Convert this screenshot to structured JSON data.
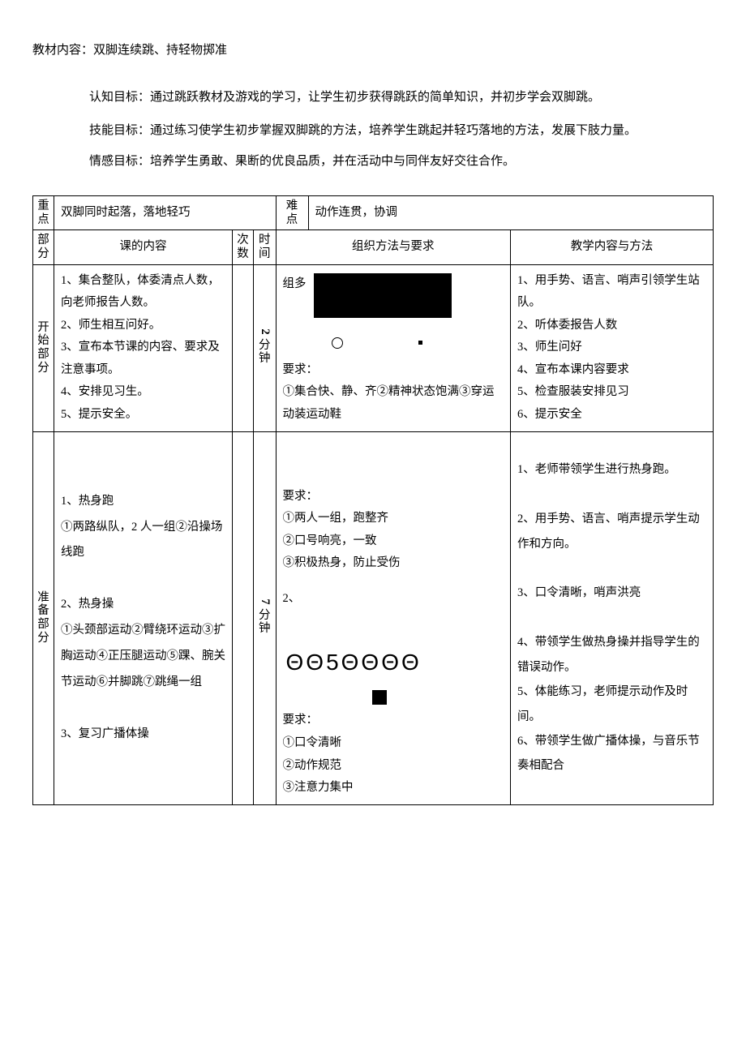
{
  "title": "教材内容：双脚连续跳、持轻物掷准",
  "objectives": {
    "cognitive": "认知目标：通过跳跃教材及游戏的学习，让学生初步获得跳跃的简单知识，并初步学会双脚跳。",
    "skill": "技能目标：通过练习使学生初步掌握双脚跳的方法，培养学生跳起并轻巧落地的方法，发展下肢力量。",
    "emotion": "情感目标：培养学生勇敢、果断的优良品质，并在活动中与同伴友好交往合作。"
  },
  "focus_row": {
    "label": "重点",
    "focus": "双脚同时起落，落地轻巧",
    "difficulty_label": "难点",
    "difficulty": "动作连贯，协调"
  },
  "headers": {
    "part": "部分",
    "content": "课的内容",
    "times": "次数",
    "duration": "时间",
    "organization": "组织方法与要求",
    "methods": "教学内容与方法"
  },
  "sections": [
    {
      "part_label": "开始部分",
      "content": "1、集合整队，体委清点人数，向老师报告人数。\n2、师生相互问好。\n3、宣布本节课的内容、要求及注意事项。\n4、安排见习生。\n5、提示安全。",
      "times": "",
      "duration_num": "2",
      "duration_unit": "分钟",
      "org_prefix": "组多",
      "org_req_label": "要求：",
      "org_req": "①集合快、静、齐②精神状态饱满③穿运动装运动鞋",
      "methods": "1、用手势、语言、哨声引领学生站队。\n2、听体委报告人数\n3、师生问好\n4、宣布本课内容要求\n5、检查服装安排见习\n6、提示安全"
    },
    {
      "part_label": "准备部分",
      "content": "1、热身跑\n①两路纵队，2 人一组②沿操场线跑\n\n2、热身操\n①头颈部运动②臂绕环运动③扩胸运动④正压腿运动⑤踝、腕关节运动⑥并脚跳⑦跳绳一组\n\n3、复习广播体操",
      "times": "",
      "duration_num": "7",
      "duration_unit": "分钟",
      "org_req1_label": "要求：",
      "org_req1": "①两人一组，跑整齐\n②口号响亮，一致\n③积极热身，防止受伤",
      "org_item2": "2、",
      "org_symbols": "ΘΘ5ΘΘΘΘ",
      "org_req2_label": "要求：",
      "org_req2": "①口令清晰\n②动作规范\n③注意力集中",
      "methods": "1、老师带领学生进行热身跑。\n\n2、用手势、语言、哨声提示学生动作和方向。\n\n3、口令清晰，哨声洪亮\n\n4、带领学生做热身操并指导学生的错误动作。\n5、体能练习，老师提示动作及时间。\n6、带领学生做广播体操，与音乐节奏相配合"
    }
  ]
}
